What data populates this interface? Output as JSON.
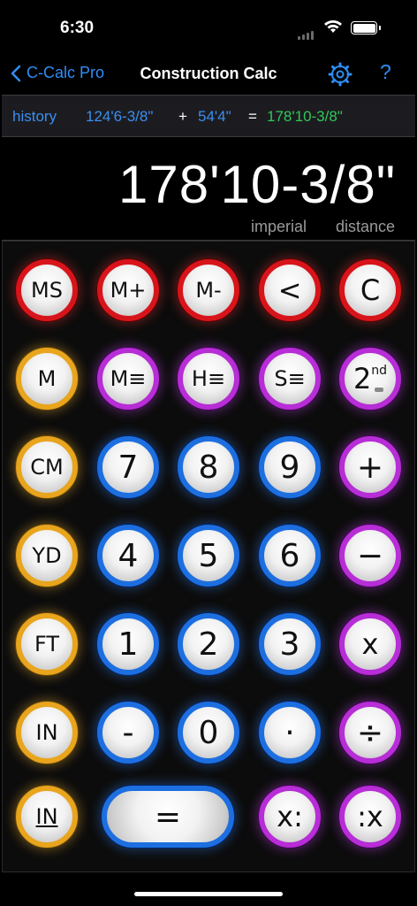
{
  "status": {
    "time": "6:30"
  },
  "nav": {
    "back_label": "C-Calc Pro",
    "title": "Construction Calc",
    "help_label": "?"
  },
  "history": {
    "label": "history",
    "operand1": "124'6-3/8\"",
    "operator": "+",
    "operand2": "54'4\"",
    "equals": "=",
    "result": "178'10-3/8\""
  },
  "display": {
    "value": "178'10-3/8\"",
    "unit_system": "imperial",
    "mode": "distance"
  },
  "keys": {
    "ms": "MS",
    "mplus": "M+",
    "mminus": "M-",
    "back": "<",
    "clear": "C",
    "m": "M",
    "mlist": "M≡",
    "hlist": "H≡",
    "slist": "S≡",
    "second": "2",
    "second_sup": "nd",
    "cm": "CM",
    "k7": "7",
    "k8": "8",
    "k9": "9",
    "plus": "+",
    "yd": "YD",
    "k4": "4",
    "k5": "5",
    "k6": "6",
    "minus": "−",
    "ft": "FT",
    "k1": "1",
    "k2": "2",
    "k3": "3",
    "times": "x",
    "in": "IN",
    "dash": "-",
    "k0": "0",
    "dot": "·",
    "divide": "÷",
    "in_under": "IN",
    "equals": "=",
    "x_colon": "x:",
    "colon_x": ":x"
  },
  "colors": {
    "red": "#d8141b",
    "orange": "#e8a51d",
    "purple": "#b72dd6",
    "blue": "#1d6fe0",
    "accent": "#2f8df5",
    "result": "#31c759"
  }
}
